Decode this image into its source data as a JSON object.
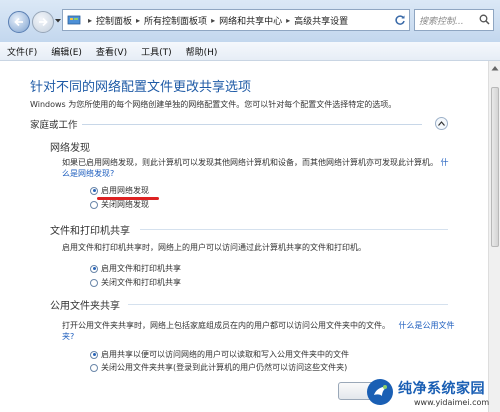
{
  "breadcrumb": [
    "控制面板",
    "所有控制面板项",
    "网络和共享中心",
    "高级共享设置"
  ],
  "search": {
    "placeholder": "搜索控制..."
  },
  "menu": [
    "文件(F)",
    "编辑(E)",
    "查看(V)",
    "工具(T)",
    "帮助(H)"
  ],
  "page": {
    "title": "针对不同的网络配置文件更改共享选项",
    "subtitle": "Windows 为您所使用的每个网络创建单独的网络配置文件。您可以针对每个配置文件选择特定的选项。",
    "group": "家庭或工作"
  },
  "sections": {
    "discovery": {
      "title": "网络发现",
      "desc": "如果已启用网络发现，则此计算机可以发现其他网络计算机和设备，而其他网络计算机亦可发现此计算机。",
      "link1": "什",
      "link2": "么是网络发现?",
      "opt_on": "启用网络发现",
      "opt_off": "关闭网络发现"
    },
    "printer": {
      "title": "文件和打印机共享",
      "desc": "启用文件和打印机共享时，网络上的用户可以访问通过此计算机共享的文件和打印机。",
      "opt_on": "启用文件和打印机共享",
      "opt_off": "关闭文件和打印机共享"
    },
    "public": {
      "title": "公用文件夹共享",
      "desc": "打开公用文件夹共享时，网络上包括家庭组成员在内的用户都可以访问公用文件夹中的文件。",
      "link1": "什么是公用文件",
      "link2": "夹?",
      "opt_on": "启用共享以便可以访问网络的用户可以读取和写入公用文件夹中的文件",
      "opt_off": "关闭公用文件夹共享(登录到此计算机的用户仍然可以访问这些文件夹)"
    }
  },
  "watermark": {
    "name": "纯净系统家园",
    "url": "www.yidaimei.com"
  },
  "colors": {
    "title": "#1e5aa6",
    "link": "#1f5fbf",
    "highlight": "#dd2222"
  }
}
